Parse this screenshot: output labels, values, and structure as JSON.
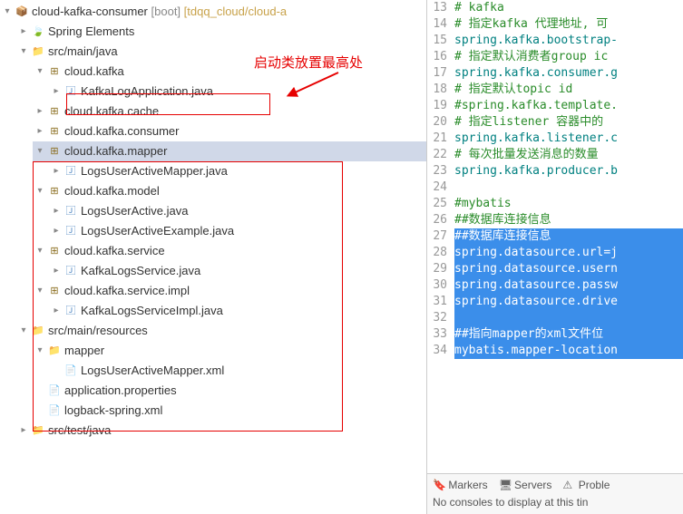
{
  "project": {
    "name": "cloud-kafka-consumer",
    "boot": "[boot]",
    "path": "[tdqq_cloud/cloud-a"
  },
  "tree": {
    "spring_elements": "Spring Elements",
    "src_main_java": "src/main/java",
    "pkg_kafka": "cloud.kafka",
    "file_kafkalogapp": "KafkaLogApplication.java",
    "pkg_cache": "cloud.kafka.cache",
    "pkg_consumer": "cloud.kafka.consumer",
    "pkg_mapper": "cloud.kafka.mapper",
    "file_mapper_java": "LogsUserActiveMapper.java",
    "pkg_model": "cloud.kafka.model",
    "file_model1": "LogsUserActive.java",
    "file_model2": "LogsUserActiveExample.java",
    "pkg_service": "cloud.kafka.service",
    "file_service": "KafkaLogsService.java",
    "pkg_service_impl": "cloud.kafka.service.impl",
    "file_service_impl": "KafkaLogsServiceImpl.java",
    "src_main_resources": "src/main/resources",
    "folder_mapper": "mapper",
    "file_mapper_xml": "LogsUserActiveMapper.xml",
    "file_app_props": "application.properties",
    "file_logback": "logback-spring.xml",
    "src_test_java": "src/test/java"
  },
  "annotation": {
    "text": "启动类放置最高处"
  },
  "code": [
    {
      "n": 13,
      "cls": "comment",
      "t": "# kafka"
    },
    {
      "n": 14,
      "cls": "comment",
      "t": "# 指定kafka 代理地址, 可"
    },
    {
      "n": 15,
      "cls": "teal",
      "t": "spring.kafka.bootstrap-"
    },
    {
      "n": 16,
      "cls": "comment",
      "t": "# 指定默认消费者group ic"
    },
    {
      "n": 17,
      "cls": "teal",
      "t": "spring.kafka.consumer.g"
    },
    {
      "n": 18,
      "cls": "comment",
      "t": "# 指定默认topic id"
    },
    {
      "n": 19,
      "cls": "comment",
      "t": "#spring.kafka.template."
    },
    {
      "n": 20,
      "cls": "comment",
      "t": "# 指定listener 容器中的"
    },
    {
      "n": 21,
      "cls": "teal",
      "t": "spring.kafka.listener.c"
    },
    {
      "n": 22,
      "cls": "comment",
      "t": "# 每次批量发送消息的数量"
    },
    {
      "n": 23,
      "cls": "teal",
      "t": "spring.kafka.producer.b"
    },
    {
      "n": 24,
      "cls": "",
      "t": ""
    },
    {
      "n": 25,
      "cls": "comment",
      "t": "#mybatis"
    },
    {
      "n": 26,
      "cls": "comment",
      "t": "##数据库连接信息"
    },
    {
      "n": 27,
      "cls": "sel",
      "t": "##数据库连接信息"
    },
    {
      "n": 28,
      "cls": "sel",
      "t": "spring.datasource.url=j"
    },
    {
      "n": 29,
      "cls": "sel",
      "t": "spring.datasource.usern"
    },
    {
      "n": 30,
      "cls": "sel",
      "t": "spring.datasource.passw"
    },
    {
      "n": 31,
      "cls": "sel",
      "t": "spring.datasource.drive"
    },
    {
      "n": 32,
      "cls": "sel",
      "t": ""
    },
    {
      "n": 33,
      "cls": "sel",
      "t": "##指向mapper的xml文件位"
    },
    {
      "n": 34,
      "cls": "sel",
      "t": "mybatis.mapper-location"
    }
  ],
  "bottom": {
    "tabs": {
      "markers": "Markers",
      "servers": "Servers",
      "problems": "Proble"
    },
    "console": "No consoles to display at this tin"
  }
}
